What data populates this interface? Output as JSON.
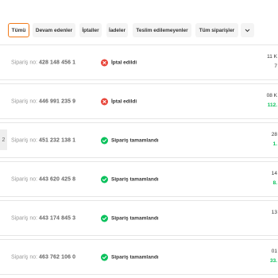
{
  "tabs": [
    {
      "label": "Tümü",
      "active": true
    },
    {
      "label": "Devam edenler"
    },
    {
      "label": "İptaller"
    },
    {
      "label": "İadeler"
    },
    {
      "label": "Teslim edilemeyenler"
    },
    {
      "label": "Tüm siparişler"
    }
  ],
  "order_label": "Sipariş no:",
  "orders": [
    {
      "number": "428 148 456 1",
      "status": "İptal edildi",
      "status_type": "cancelled",
      "date": "11 K",
      "price": "7"
    },
    {
      "number": "446 991 235 9",
      "status": "İptal edildi",
      "status_type": "cancelled",
      "date": "08 K",
      "price": "112."
    },
    {
      "number": "451 232 138 1",
      "status": "Sipariş tamamlandı",
      "status_type": "completed",
      "date": "28",
      "price": "1.",
      "edge_label": "2"
    },
    {
      "number": "443 620 425 8",
      "status": "Sipariş tamamlandı",
      "status_type": "completed",
      "date": "14",
      "price": "8."
    },
    {
      "number": "443 174 845 3",
      "status": "Sipariş tamamlandı",
      "status_type": "completed",
      "date": "13",
      "price": ""
    },
    {
      "number": "463 762 106 0",
      "status": "Sipariş tamamlandı",
      "status_type": "completed",
      "date": "01",
      "price": "33."
    }
  ],
  "colors": {
    "accent": "#f27a1a",
    "success": "#0bc15c",
    "error": "#e8463b"
  }
}
